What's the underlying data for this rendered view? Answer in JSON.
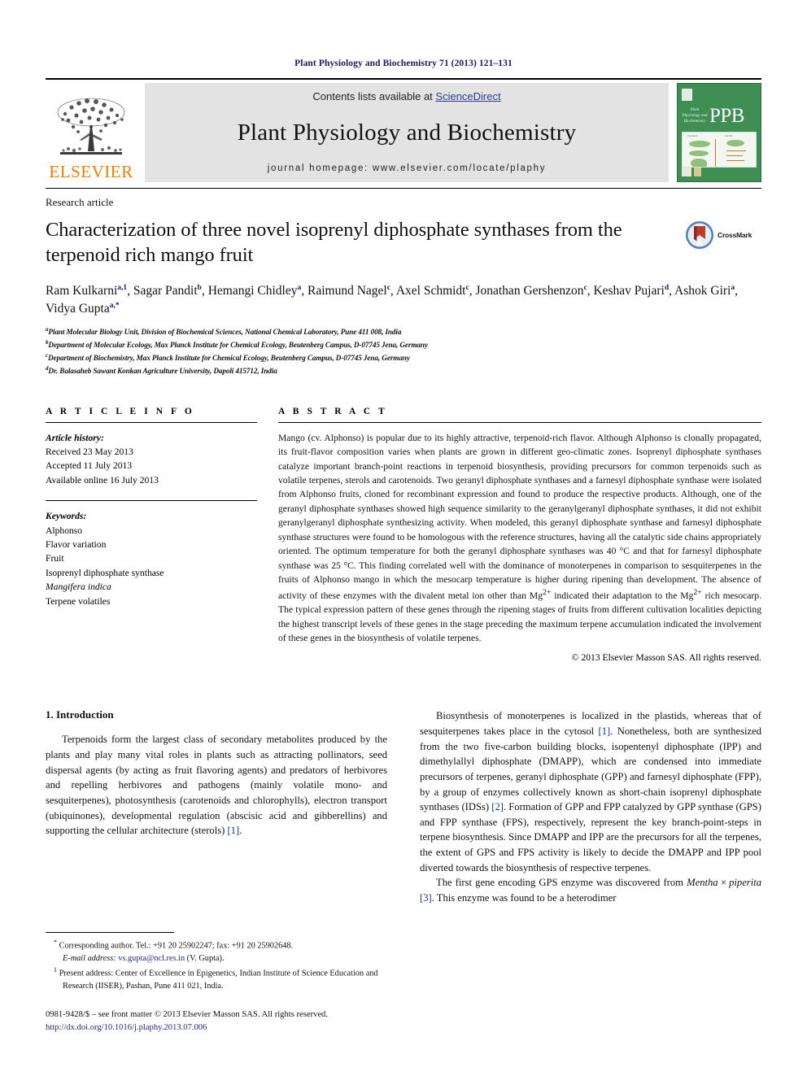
{
  "running_head": "Plant Physiology and Biochemistry 71 (2013) 121–131",
  "masthead": {
    "contents_prefix": "Contents lists available at ",
    "sciencedirect": "ScienceDirect",
    "journal_title": "Plant Physiology and Biochemistry",
    "homepage": "journal homepage: www.elsevier.com/locate/plaphy",
    "elsevier_wordmark": "ELSEVIER",
    "ppb_acronym": "PPB",
    "ppb_subtitle": "Plant Physiology and Biochemistry",
    "link_color": "#2b3a8f",
    "panel_color": "#e3e3e3",
    "cover_color": "#3f8f54",
    "elsevier_orange": "#ef7d00"
  },
  "article": {
    "type": "Research article",
    "title": "Characterization of three novel isoprenyl diphosphate synthases from the terpenoid rich mango fruit",
    "crossmark_label": "CrossMark",
    "authors_html": "Ram Kulkarni<sup class=\"aff\">a,1</sup>, Sagar Pandit<sup class=\"aff\">b</sup>, Hemangi Chidley<sup class=\"aff\">a</sup>, Raimund Nagel<sup class=\"aff\">c</sup>, Axel Schmidt<sup class=\"aff\">c</sup>, Jonathan Gershenzon<sup class=\"aff\">c</sup>, Keshav Pujari<sup class=\"aff\">d</sup>, Ashok Giri<sup class=\"aff\">a</sup>, Vidya Gupta<sup class=\"aff\">a,<span class=\"corr-star\">*</span></sup>",
    "affiliations": [
      {
        "marker": "a",
        "text": "Plant Molecular Biology Unit, Division of Biochemical Sciences, National Chemical Laboratory, Pune 411 008, India"
      },
      {
        "marker": "b",
        "text": "Department of Molecular Ecology, Max Planck Institute for Chemical Ecology, Beutenberg Campus, D-07745 Jena, Germany"
      },
      {
        "marker": "c",
        "text": "Department of Biochemistry, Max Planck Institute for Chemical Ecology, Beutenberg Campus, D-07745 Jena, Germany"
      },
      {
        "marker": "d",
        "text": "Dr. Balasaheb Sawant Konkan Agriculture University, Dapoli 415712, India"
      }
    ]
  },
  "article_info": {
    "heading": "A R T I C L E   I N F O",
    "history_label": "Article history:",
    "history": [
      "Received 23 May 2013",
      "Accepted 11 July 2013",
      "Available online 16 July 2013"
    ],
    "keywords_label": "Keywords:",
    "keywords": [
      "Alphonso",
      "Flavor variation",
      "Fruit",
      "Isoprenyl diphosphate synthase",
      "Mangifera indica",
      "Terpene volatiles"
    ],
    "italic_keyword": "Mangifera indica"
  },
  "abstract": {
    "heading": "A B S T R A C T",
    "text_html": "Mango (cv. Alphonso) is popular due to its highly attractive, terpenoid-rich flavor. Although Alphonso is clonally propagated, its fruit-flavor composition varies when plants are grown in different geo-climatic zones. Isoprenyl diphosphate synthases catalyze important branch-point reactions in terpenoid biosynthesis, providing precursors for common terpenoids such as volatile terpenes, sterols and carotenoids. Two geranyl diphosphate synthases and a farnesyl diphosphate synthase were isolated from Alphonso fruits, cloned for recombinant expression and found to produce the respective products. Although, one of the geranyl diphosphate synthases showed high sequence similarity to the geranylgeranyl diphosphate synthases, it did not exhibit geranylgeranyl diphosphate synthesizing activity. When modeled, this geranyl diphosphate synthase and farnesyl diphosphate synthase structures were found to be homologous with the reference structures, having all the catalytic side chains appropriately oriented. The optimum temperature for both the geranyl diphosphate synthases was 40&nbsp;&deg;C and that for farnesyl diphosphate synthase was 25&nbsp;&deg;C. This finding correlated well with the dominance of monoterpenes in comparison to sesquiterpenes in the fruits of Alphonso mango in which the mesocarp temperature is higher during ripening than development. The absence of activity of these enzymes with the divalent metal ion other than Mg<sup>2+</sup> indicated their adaptation to the Mg<sup>2+</sup> rich mesocarp. The typical expression pattern of these genes through the ripening stages of fruits from different cultivation localities depicting the highest transcript levels of these genes in the stage preceding the maximum terpene accumulation indicated the involvement of these genes in the biosynthesis of volatile terpenes.",
    "copyright": "© 2013 Elsevier Masson SAS. All rights reserved."
  },
  "body": {
    "section_number_title": "1.  Introduction",
    "left_paragraph_html": "Terpenoids form the largest class of secondary metabolites produced by the plants and play many vital roles in plants such as attracting pollinators, seed dispersal agents (by acting as fruit flavoring agents) and predators of herbivores and repelling herbivores and pathogens (mainly volatile mono- and sesquiterpenes), photosynthesis (carotenoids and chlorophylls), electron transport (ubiquinones), developmental regulation (abscisic acid and gibberellins) and supporting the cellular architecture (sterols) <span class=\"ref\">[1]</span>.",
    "right_paragraph_1_html": "Biosynthesis of monoterpenes is localized in the plastids, whereas that of sesquiterpenes takes place in the cytosol <span class=\"ref\">[1]</span>. Nonetheless, both are synthesized from the two five-carbon building blocks, isopentenyl diphosphate (IPP) and dimethylallyl diphosphate (DMAPP), which are condensed into immediate precursors of terpenes, geranyl diphosphate (GPP) and farnesyl diphosphate (FPP), by a group of enzymes collectively known as short-chain isoprenyl diphosphate synthases (IDSs) <span class=\"ref\">[2]</span>. Formation of GPP and FPP catalyzed by GPP synthase (GPS) and FPP synthase (FPS), respectively, represent the key branch-point-steps in terpene biosynthesis. Since DMAPP and IPP are the precursors for all the terpenes, the extent of GPS and FPS activity is likely to decide the DMAPP and IPP pool diverted towards the biosynthesis of respective terpenes.",
    "right_paragraph_2_html": "The first gene encoding GPS enzyme was discovered from <span class=\"sp-italic\">Mentha&thinsp;×&thinsp;piperita</span> <span class=\"ref\">[3]</span>. This enzyme was found to be a heterodimer"
  },
  "footnotes": {
    "corresponding_html": "<sup>*</sup> Corresponding author. Tel.: +91 20 25902247; fax: +91 20 25902648.",
    "email_html": "<span class=\"it\">E-mail address:</span> <span class=\"mail\">vs.gupta@ncl.res.in</span> (V. Gupta).",
    "present_address_html": "<sup>1</sup> Present address: Center of Excellence in Epigenetics, Indian Institute of Science Education and Research (IISER), Pashan, Pune 411 021, India."
  },
  "footer": {
    "issn_html": "0981-9428/$ – see front matter © 2013 Elsevier Masson SAS. All rights reserved.",
    "doi": "http://dx.doi.org/10.1016/j.plaphy.2013.07.006"
  }
}
